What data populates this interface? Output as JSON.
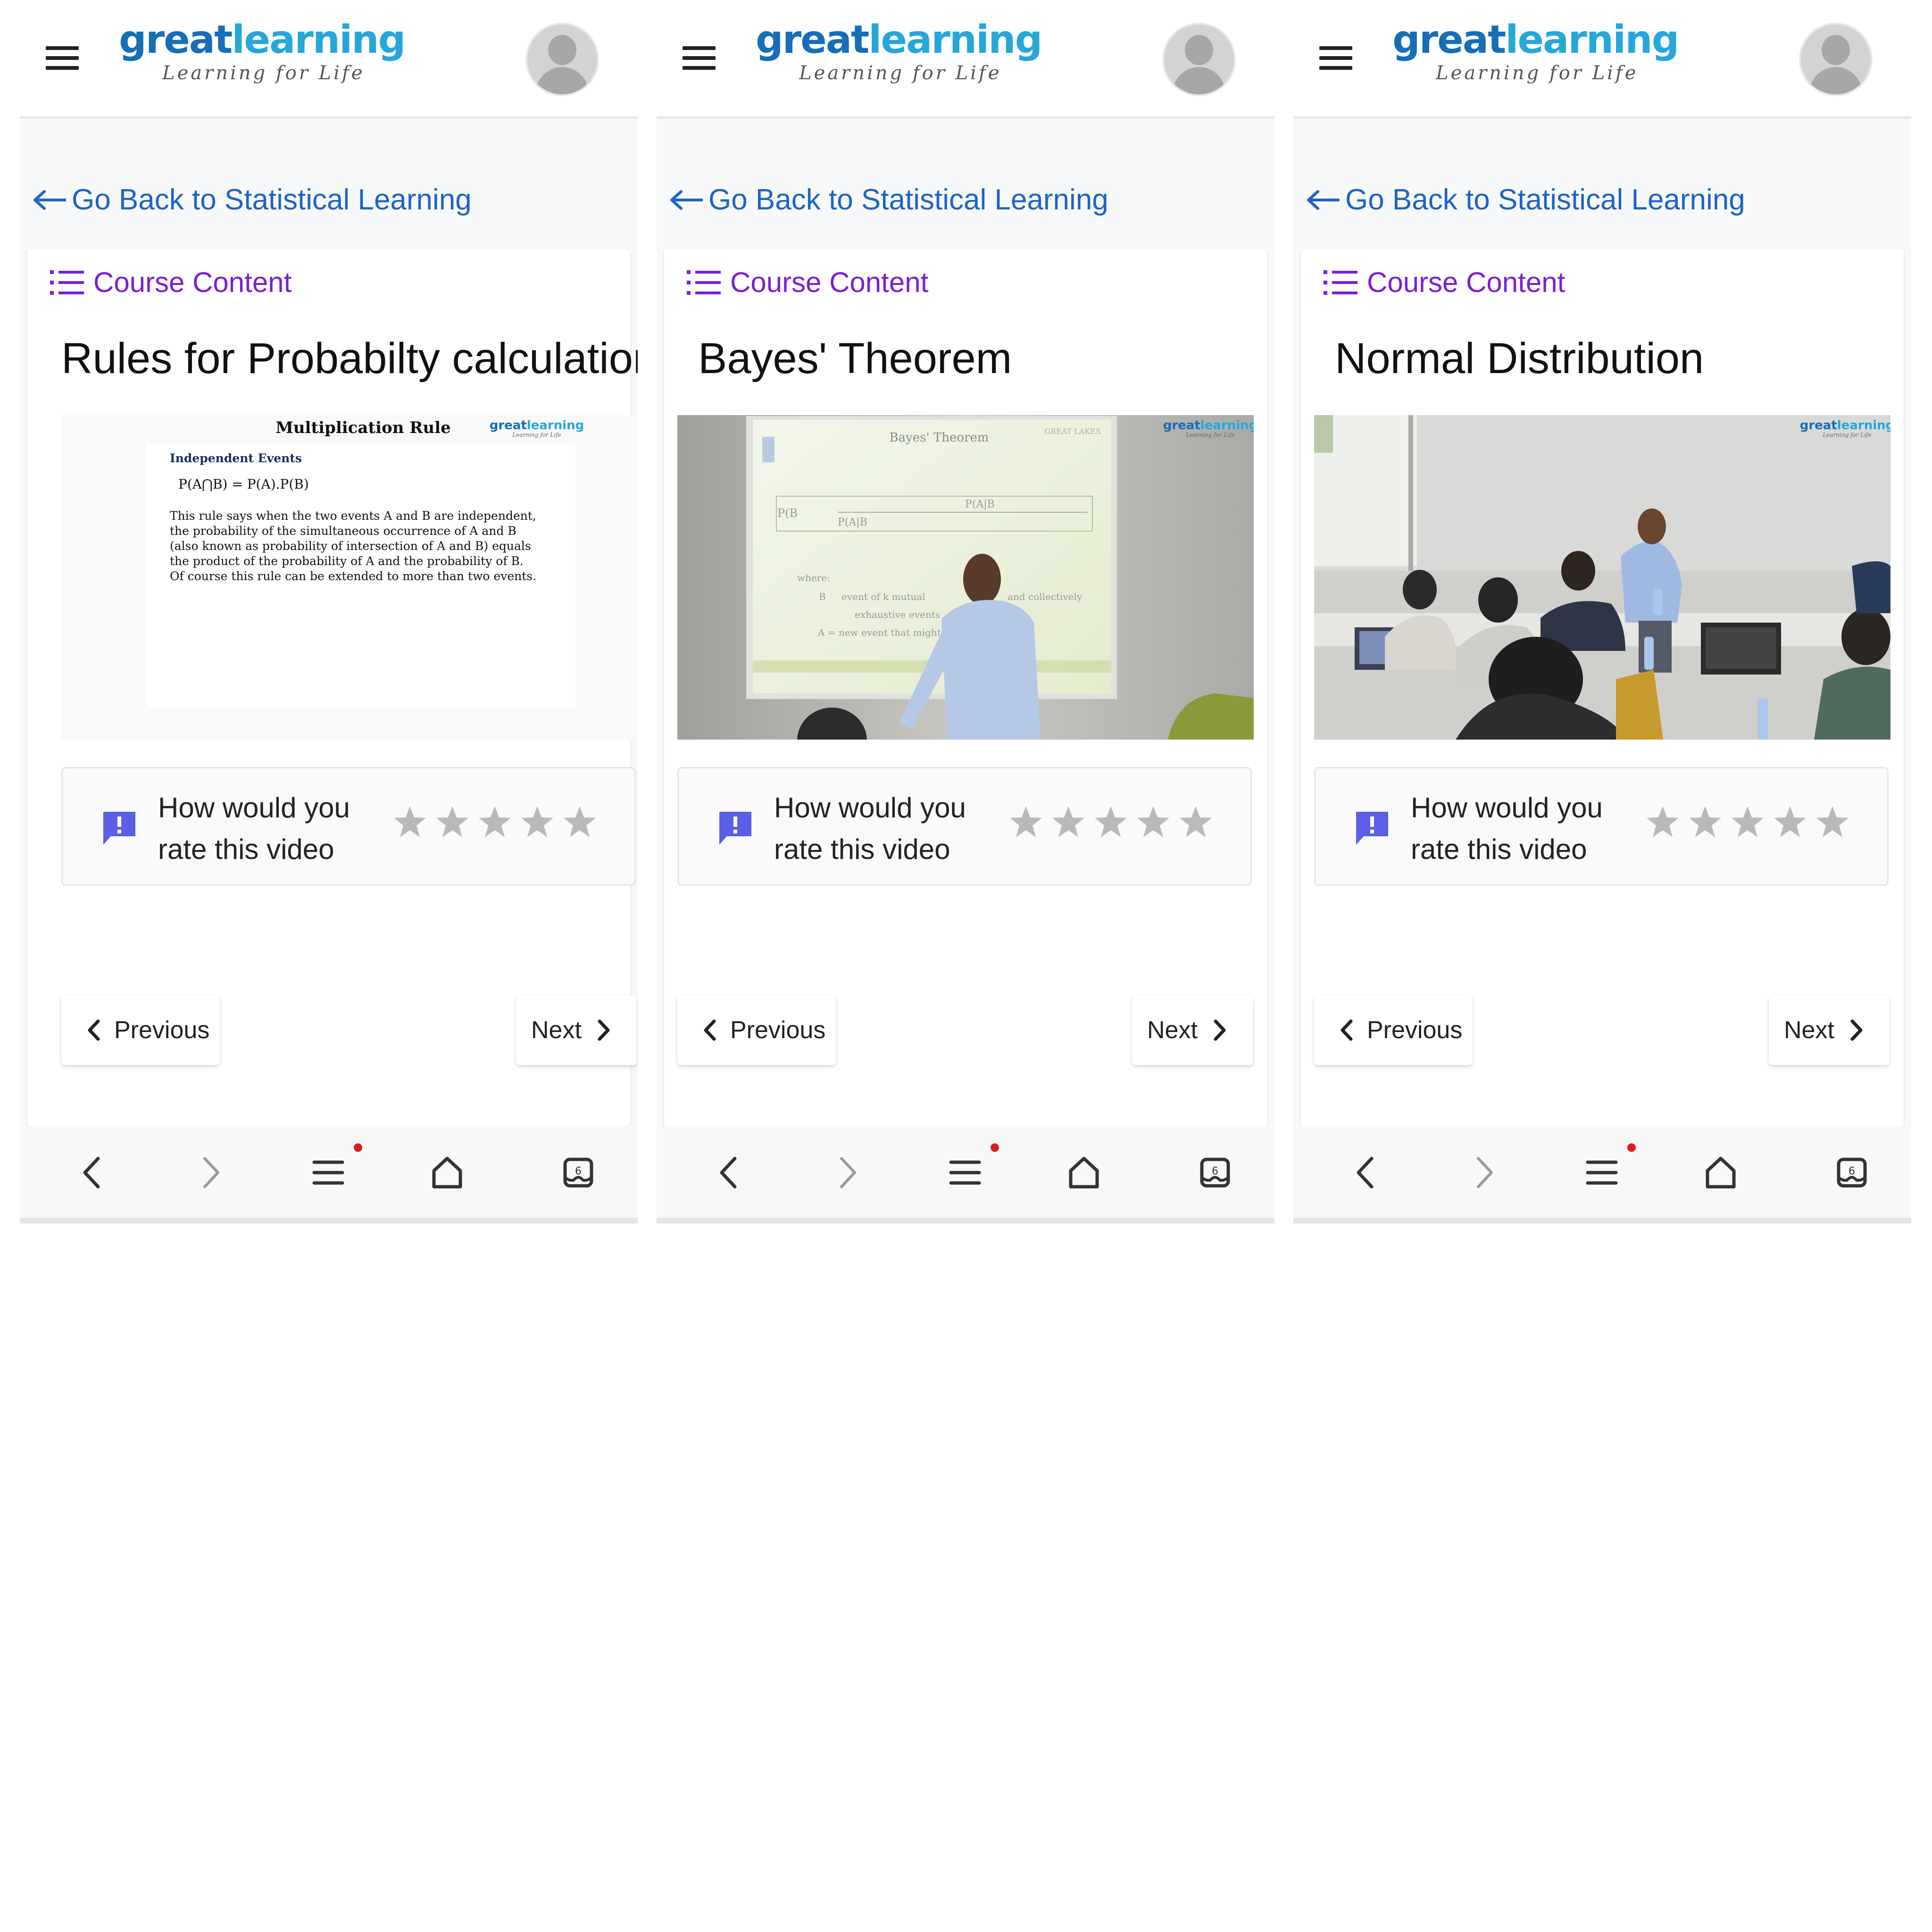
{
  "panels": [
    {
      "header": {
        "logo_primary": "great",
        "logo_secondary": "learning",
        "tagline": "Learning for Life"
      },
      "back_link": "Go Back to Statistical Learning",
      "course_content_label": "Course Content",
      "lecture_title": "Rules for Probabilty calculation",
      "video": {
        "kind": "slide",
        "watermark_primary": "great",
        "watermark_secondary": "learning",
        "watermark_tagline": "Learning for Life",
        "slide_title": "Multiplication Rule",
        "slide_subtitle": "Independent Events",
        "slide_formula": "P(A⋂B) = P(A).P(B)",
        "slide_body": [
          "This rule says when the two events A and B are independent,",
          "the probability of the simultaneous occurrence of A and B",
          "(also known as probability of intersection of A and B) equals",
          "the product of the probability of A and the probability of B.",
          "Of course this rule can be extended to more than two events."
        ]
      },
      "rating": {
        "line1": "How would you",
        "line2": "rate this video",
        "stars": 0,
        "max_stars": 5
      },
      "prev_label": "Previous",
      "next_label": "Next",
      "browser_tab_count": "6"
    },
    {
      "header": {
        "logo_primary": "great",
        "logo_secondary": "learning",
        "tagline": "Learning for Life"
      },
      "back_link": "Go Back to Statistical Learning",
      "course_content_label": "Course Content",
      "lecture_title": "Bayes' Theorem",
      "video": {
        "kind": "lecture-projector",
        "watermark_primary": "great",
        "watermark_secondary": "learning",
        "watermark_tagline": "Learning for Life",
        "screen_title": "Bayes' Theorem",
        "screen_brand": "GREAT LAKES",
        "screen_formula_lhs": "P(B",
        "screen_formula_num": "P(A|B",
        "screen_formula_den": "P(A|B",
        "screen_where": "where:",
        "screen_line1": "B",
        "screen_line1b": "event of k mutual",
        "screen_line1c": "and collectively",
        "screen_line2": "exhaustive events",
        "screen_line3": "A = new event that might i"
      },
      "rating": {
        "line1": "How would you",
        "line2": "rate this video",
        "stars": 0,
        "max_stars": 5
      },
      "prev_label": "Previous",
      "next_label": "Next",
      "browser_tab_count": "6"
    },
    {
      "header": {
        "logo_primary": "great",
        "logo_secondary": "learning",
        "tagline": "Learning for Life"
      },
      "back_link": "Go Back to Statistical Learning",
      "course_content_label": "Course Content",
      "lecture_title": "Normal Distribution",
      "video": {
        "kind": "lecture-classroom",
        "watermark_primary": "great",
        "watermark_secondary": "learning",
        "watermark_tagline": "Learning for Life"
      },
      "rating": {
        "line1": "How would you",
        "line2": "rate this video",
        "stars": 0,
        "max_stars": 5
      },
      "prev_label": "Previous",
      "next_label": "Next",
      "browser_tab_count": "6"
    }
  ],
  "colors": {
    "brand_dark": "#176db6",
    "brand_light": "#27a6d9",
    "link_blue": "#1c64c4",
    "course_purple": "#7a1fd6",
    "feedback_icon": "#5b5fe6",
    "star_empty": "#b9b9b9",
    "notification_dot": "#e01a1a"
  },
  "icons": {
    "menu": "hamburger-icon",
    "avatar": "user-avatar-icon",
    "back": "arrow-left-icon",
    "list": "list-icon",
    "feedback": "message-alert-icon",
    "star": "star-icon",
    "prev": "chevron-left-icon",
    "next": "chevron-right-icon",
    "home": "home-icon",
    "tabs": "tabs-icon",
    "browser_menu": "menu-lines-icon"
  }
}
